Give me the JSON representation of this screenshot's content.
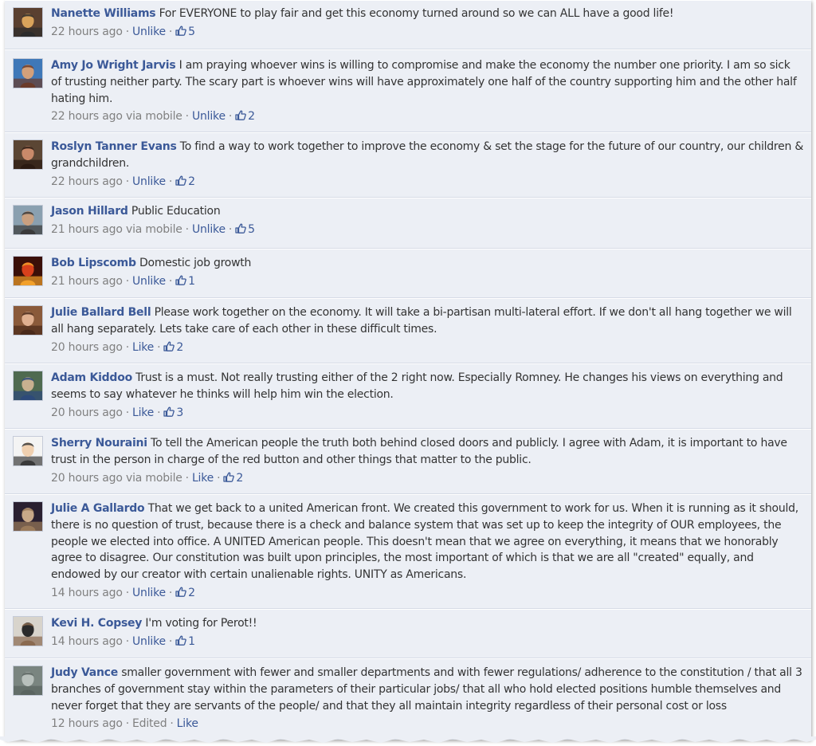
{
  "comments": [
    {
      "author": "Nanette Williams",
      "text": "For EVERYONE to play fair and get this economy turned around so we can ALL have a good life!",
      "time": "22 hours ago",
      "via": "",
      "action": "Unlike",
      "likes": "5",
      "avatar": {
        "bg": "#5a4030",
        "fg": "#d9a35b",
        "accent": "#2c2c2c"
      }
    },
    {
      "author": "Amy Jo Wright Jarvis",
      "text": "I am praying whoever wins is willing to compromise and make the economy the number one priority. I am so sick of trusting neither party. The scary part is whoever wins will have approximately one half of the country supporting him and the other half hating him.",
      "time": "22 hours ago",
      "via": "via mobile",
      "action": "Unlike",
      "likes": "2",
      "avatar": {
        "bg": "#3f78b8",
        "fg": "#d3a07a",
        "accent": "#6b3b2a"
      }
    },
    {
      "author": "Roslyn Tanner Evans",
      "text": "To find a way to work together to improve the economy & set the stage for the future of our country, our children & grandchildren.",
      "time": "22 hours ago",
      "via": "",
      "action": "Unlike",
      "likes": "2",
      "avatar": {
        "bg": "#5b4634",
        "fg": "#c98a6a",
        "accent": "#2a1a12"
      }
    },
    {
      "author": "Jason Hillard",
      "text": "Public Education",
      "time": "21 hours ago",
      "via": "via mobile",
      "action": "Unlike",
      "likes": "5",
      "avatar": {
        "bg": "#8aa0b0",
        "fg": "#c9a080",
        "accent": "#3a3a3a"
      }
    },
    {
      "author": "Bob Lipscomb",
      "text": "Domestic job growth",
      "time": "21 hours ago",
      "via": "",
      "action": "Unlike",
      "likes": "1",
      "avatar": {
        "bg": "#3a0f08",
        "fg": "#d8401c",
        "accent": "#f2a02a"
      }
    },
    {
      "author": "Julie Ballard Bell",
      "text": "Please work together on the economy. It will take a bi-partisan multi-lateral effort. If we don't all hang together we will all hang separately. Lets take care of each other in these difficult times.",
      "time": "20 hours ago",
      "via": "",
      "action": "Like",
      "likes": "2",
      "avatar": {
        "bg": "#8a5a3a",
        "fg": "#e0b090",
        "accent": "#4a2a1a"
      }
    },
    {
      "author": "Adam Kiddoo",
      "text": "Trust is a must. Not really trusting either of the 2 right now. Especially Romney. He changes his views on everything and seems to say whatever he thinks will help him win the election.",
      "time": "20 hours ago",
      "via": "",
      "action": "Like",
      "likes": "3",
      "avatar": {
        "bg": "#4f6a50",
        "fg": "#c8b090",
        "accent": "#2d4a7a"
      }
    },
    {
      "author": "Sherry Nouraini",
      "text": "To tell the American people the truth both behind closed doors and publicly. I agree with Adam, it is important to have trust in the person in charge of the red button and other things that matter to the public.",
      "time": "20 hours ago",
      "via": "via mobile",
      "action": "Like",
      "likes": "2",
      "avatar": {
        "bg": "#f4f4f4",
        "fg": "#f0d0b0",
        "accent": "#3a3a3a"
      }
    },
    {
      "author": "Julie A Gallardo",
      "text": "That we get back to a united American front. We created this government to work for us. When it is running as it should, there is no question of trust, because there is a check and balance system that was set up to keep the integrity of OUR employees, the people we elected into office. A UNITED American people. This doesn't mean that we agree on everything, it means that we honorably agree to disagree. Our constitution was built upon principles, the most important of which is that we are all \"created\" equally, and endowed by our creator with certain unalienable rights. UNITY as Americans.",
      "time": "14 hours ago",
      "via": "",
      "action": "Unlike",
      "likes": "2",
      "avatar": {
        "bg": "#2a2030",
        "fg": "#c8a888",
        "accent": "#9a7a5a"
      }
    },
    {
      "author": "Kevi H. Copsey",
      "text": "I'm voting for Perot!!",
      "time": "14 hours ago",
      "via": "",
      "action": "Unlike",
      "likes": "1",
      "avatar": {
        "bg": "#d8d4cc",
        "fg": "#2a2a2a",
        "accent": "#8a6a50"
      }
    },
    {
      "author": "Judy Vance",
      "text": "smaller government with fewer and smaller departments and with fewer regulations/ adherence to the constitution / that all 3 branches of government stay within the parameters of their particular jobs/ that all who hold elected positions humble themselves and never forget that they are servants of the people/ and that they all maintain integrity regardless of their personal cost or loss",
      "time": "12 hours ago",
      "via": "",
      "edited": "Edited",
      "action": "Like",
      "likes": "",
      "avatar": {
        "bg": "#7a8580",
        "fg": "#b8c0bc",
        "accent": "#5a6460"
      }
    }
  ],
  "separator": "·"
}
